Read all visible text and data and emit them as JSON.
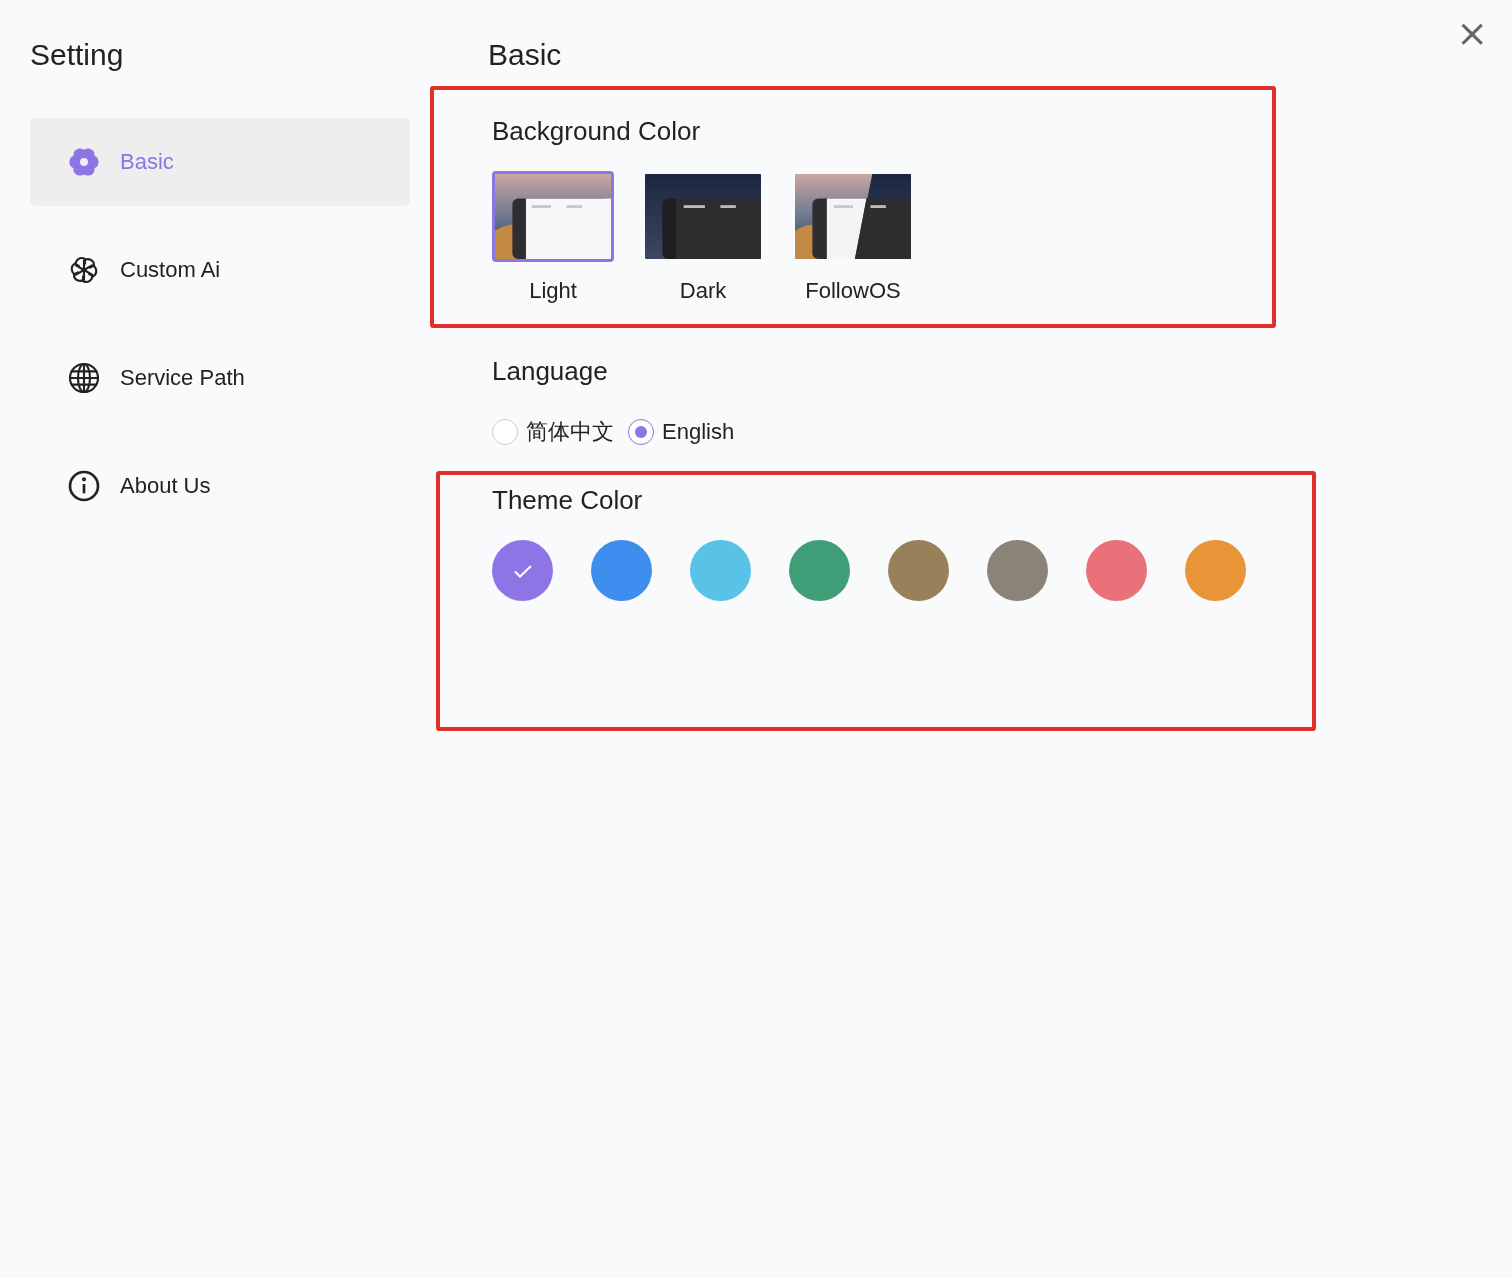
{
  "sidebar": {
    "title": "Setting",
    "items": [
      {
        "label": "Basic",
        "kind": "flower",
        "selected": true
      },
      {
        "label": "Custom Ai",
        "kind": "knot",
        "selected": false
      },
      {
        "label": "Service Path",
        "kind": "globe",
        "selected": false
      },
      {
        "label": "About Us",
        "kind": "info",
        "selected": false
      }
    ]
  },
  "main": {
    "title": "Basic",
    "close": "×",
    "sections": [
      {
        "kind": "appearance",
        "title": "Background Color",
        "highlighted": true,
        "options": [
          {
            "label": "Light",
            "kind": "light",
            "selected": true
          },
          {
            "label": "Dark",
            "kind": "dark",
            "selected": false
          },
          {
            "label": "FollowOS",
            "kind": "followos",
            "selected": false
          }
        ]
      },
      {
        "kind": "radio",
        "title": "Language",
        "highlighted": false,
        "options": [
          {
            "label": "简体中文",
            "selected": false
          },
          {
            "label": "English",
            "selected": true
          }
        ]
      },
      {
        "kind": "swatches",
        "title": "Theme Color",
        "highlighted": true,
        "options": [
          {
            "color": "#8e75e6",
            "selected": true
          },
          {
            "color": "#3e8ef0",
            "selected": false
          },
          {
            "color": "#5bc2e7",
            "selected": false
          },
          {
            "color": "#3f9e78",
            "selected": false
          },
          {
            "color": "#98805a",
            "selected": false
          },
          {
            "color": "#8c8378",
            "selected": false
          },
          {
            "color": "#e8717a",
            "selected": false
          },
          {
            "color": "#ea9438",
            "selected": false
          }
        ]
      }
    ]
  }
}
